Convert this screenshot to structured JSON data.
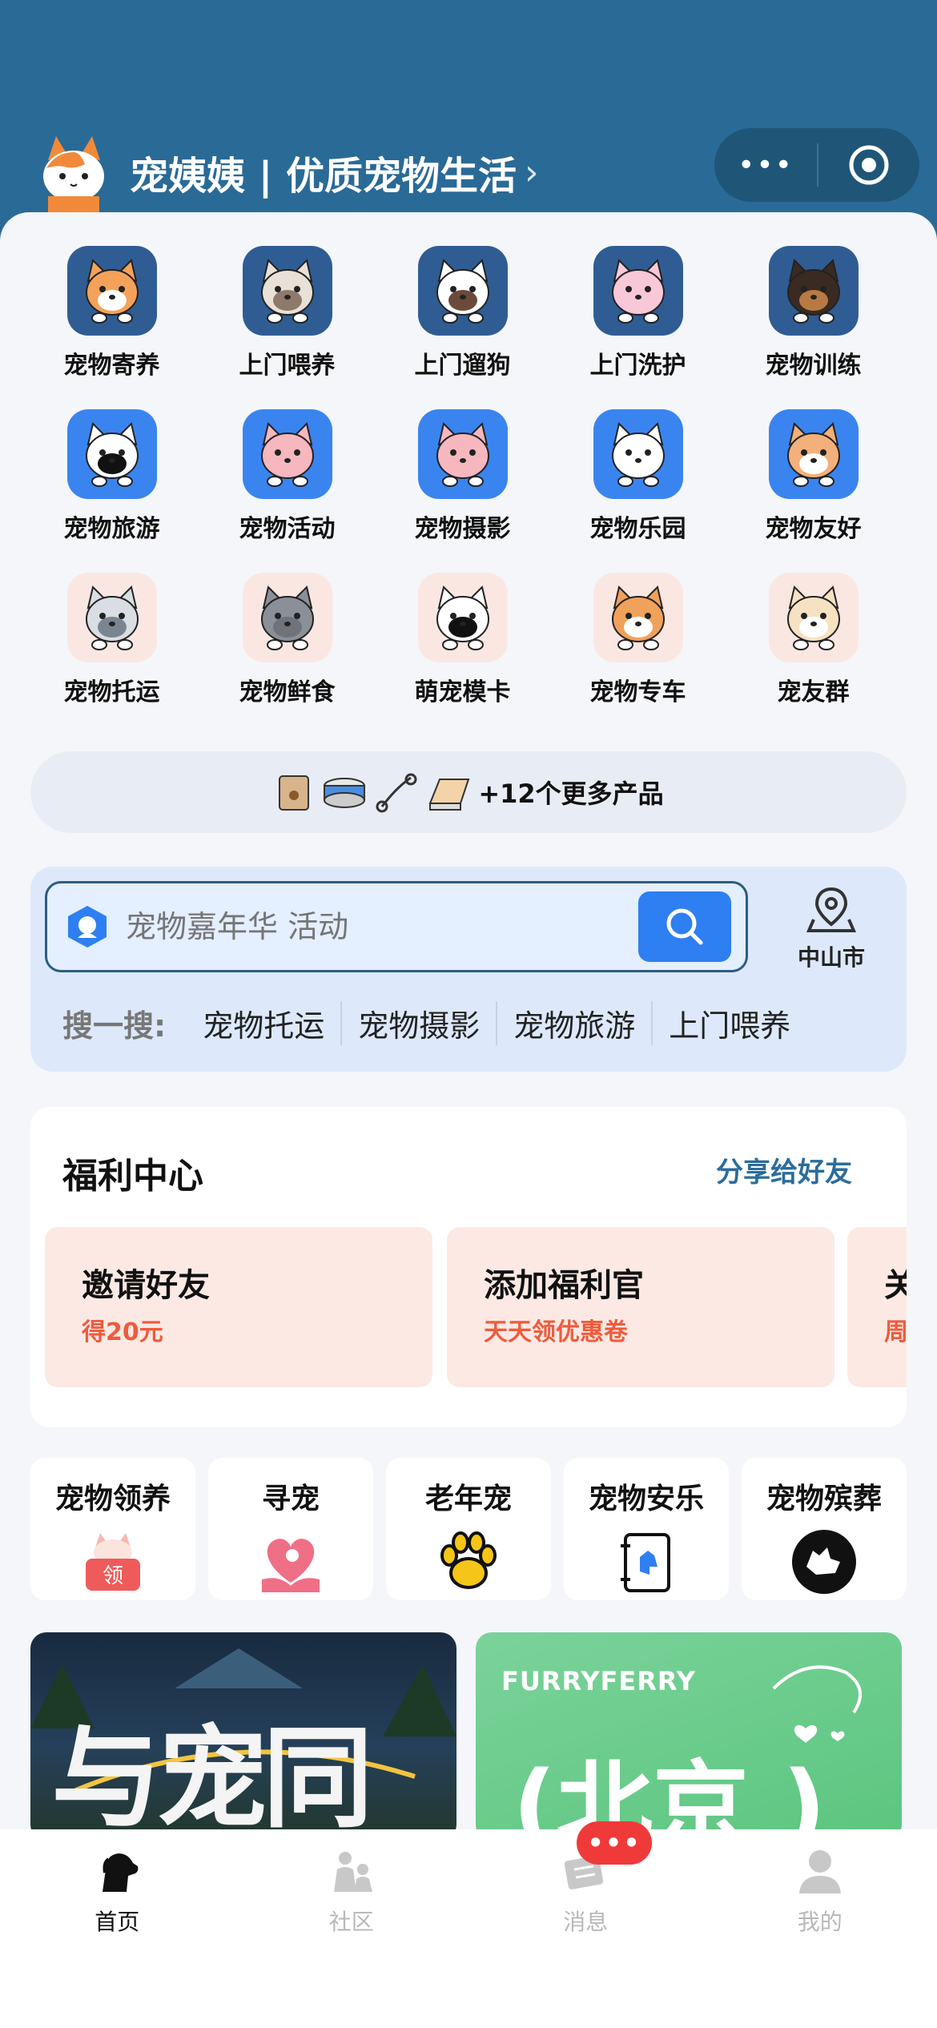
{
  "header": {
    "title": "宠姨姨 | 优质宠物生活",
    "chevron": "›",
    "capsule_more": "•••"
  },
  "grid": [
    {
      "label": "宠物寄养",
      "icon": "shiba-dog-icon",
      "style": "dark"
    },
    {
      "label": "上门喂养",
      "icon": "ragdoll-cat-icon",
      "style": "dark"
    },
    {
      "label": "上门遛狗",
      "icon": "puppy-icon",
      "style": "dark"
    },
    {
      "label": "上门洗护",
      "icon": "pink-cat-icon",
      "style": "dark"
    },
    {
      "label": "宠物训练",
      "icon": "rottweiler-icon",
      "style": "dark"
    },
    {
      "label": "宠物旅游",
      "icon": "border-collie-icon",
      "style": "blue"
    },
    {
      "label": "宠物活动",
      "icon": "pig-icon",
      "style": "blue"
    },
    {
      "label": "宠物摄影",
      "icon": "pig-camera-icon",
      "style": "blue"
    },
    {
      "label": "宠物乐园",
      "icon": "duck-icon",
      "style": "blue"
    },
    {
      "label": "宠物友好",
      "icon": "orange-cat-icon",
      "style": "blue"
    },
    {
      "label": "宠物托运",
      "icon": "carrier-cat-icon",
      "style": "pink"
    },
    {
      "label": "宠物鲜食",
      "icon": "gray-cat-icon",
      "style": "pink"
    },
    {
      "label": "萌宠模卡",
      "icon": "tuxedo-cat-icon",
      "style": "pink"
    },
    {
      "label": "宠物专车",
      "icon": "corgi-icon",
      "style": "pink"
    },
    {
      "label": "宠友群",
      "icon": "cream-dog-icon",
      "style": "pink"
    }
  ],
  "more_products": {
    "label": "+12个更多产品"
  },
  "search": {
    "placeholder": "宠物嘉年华 活动",
    "city": "中山市",
    "hot_label": "搜一搜:",
    "hot_tags": [
      "宠物托运",
      "宠物摄影",
      "宠物旅游",
      "上门喂养"
    ]
  },
  "welfare": {
    "title": "福利中心",
    "share": "分享给好友",
    "cards": [
      {
        "title": "邀请好友",
        "subtitle": "得20元"
      },
      {
        "title": "添加福利官",
        "subtitle": "天天领优惠卷"
      },
      {
        "title": "关",
        "subtitle": "周"
      }
    ]
  },
  "services": [
    {
      "label": "宠物领养",
      "icon": "adopt-cat-icon",
      "badge": "领"
    },
    {
      "label": "寻宠",
      "icon": "heart-hand-icon"
    },
    {
      "label": "老年宠",
      "icon": "paw-icon"
    },
    {
      "label": "宠物安乐",
      "icon": "dog-book-icon"
    },
    {
      "label": "宠物殡葬",
      "icon": "pet-ferry-icon"
    }
  ],
  "banners": [
    {
      "text": "与宠同行"
    },
    {
      "brand": "FURRYFERRY",
      "city": "(北京 )"
    }
  ],
  "tabbar": [
    {
      "label": "首页",
      "icon": "dog-head-icon",
      "active": true
    },
    {
      "label": "社区",
      "icon": "community-icon",
      "active": false
    },
    {
      "label": "消息",
      "icon": "message-icon",
      "active": false
    },
    {
      "label": "我的",
      "icon": "profile-icon",
      "active": false
    }
  ],
  "message_badge": "•••",
  "colors": {
    "header": "#2a6a96",
    "accent": "#2e7ff2",
    "welfare_red": "#ef5b3c",
    "badge": "#f03a3a"
  }
}
